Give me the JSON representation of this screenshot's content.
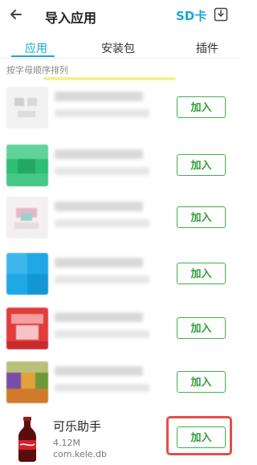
{
  "header": {
    "title": "导入应用",
    "sd_label": "SD卡",
    "back_icon": "arrow-left-icon",
    "import_icon": "download-tray-icon"
  },
  "tabs": [
    {
      "label": "应用",
      "active": true
    },
    {
      "label": "安装包",
      "active": false
    },
    {
      "label": "插件",
      "active": false
    }
  ],
  "sort_label": "按字母顺序排列",
  "apps": [
    {
      "add_label": "加入"
    },
    {
      "add_label": "加入"
    },
    {
      "add_label": "加入"
    },
    {
      "add_label": "加入"
    },
    {
      "add_label": "加入"
    },
    {
      "add_label": "加入"
    }
  ],
  "last_app": {
    "name": "可乐助手",
    "size": "4.12M",
    "package": "com.kele.db",
    "add_label": "加入",
    "icon": "cola-bottle-icon"
  },
  "colors": {
    "accent": "#1ba6d8",
    "add_button": "#42b04b",
    "highlight": "#e0504a"
  }
}
